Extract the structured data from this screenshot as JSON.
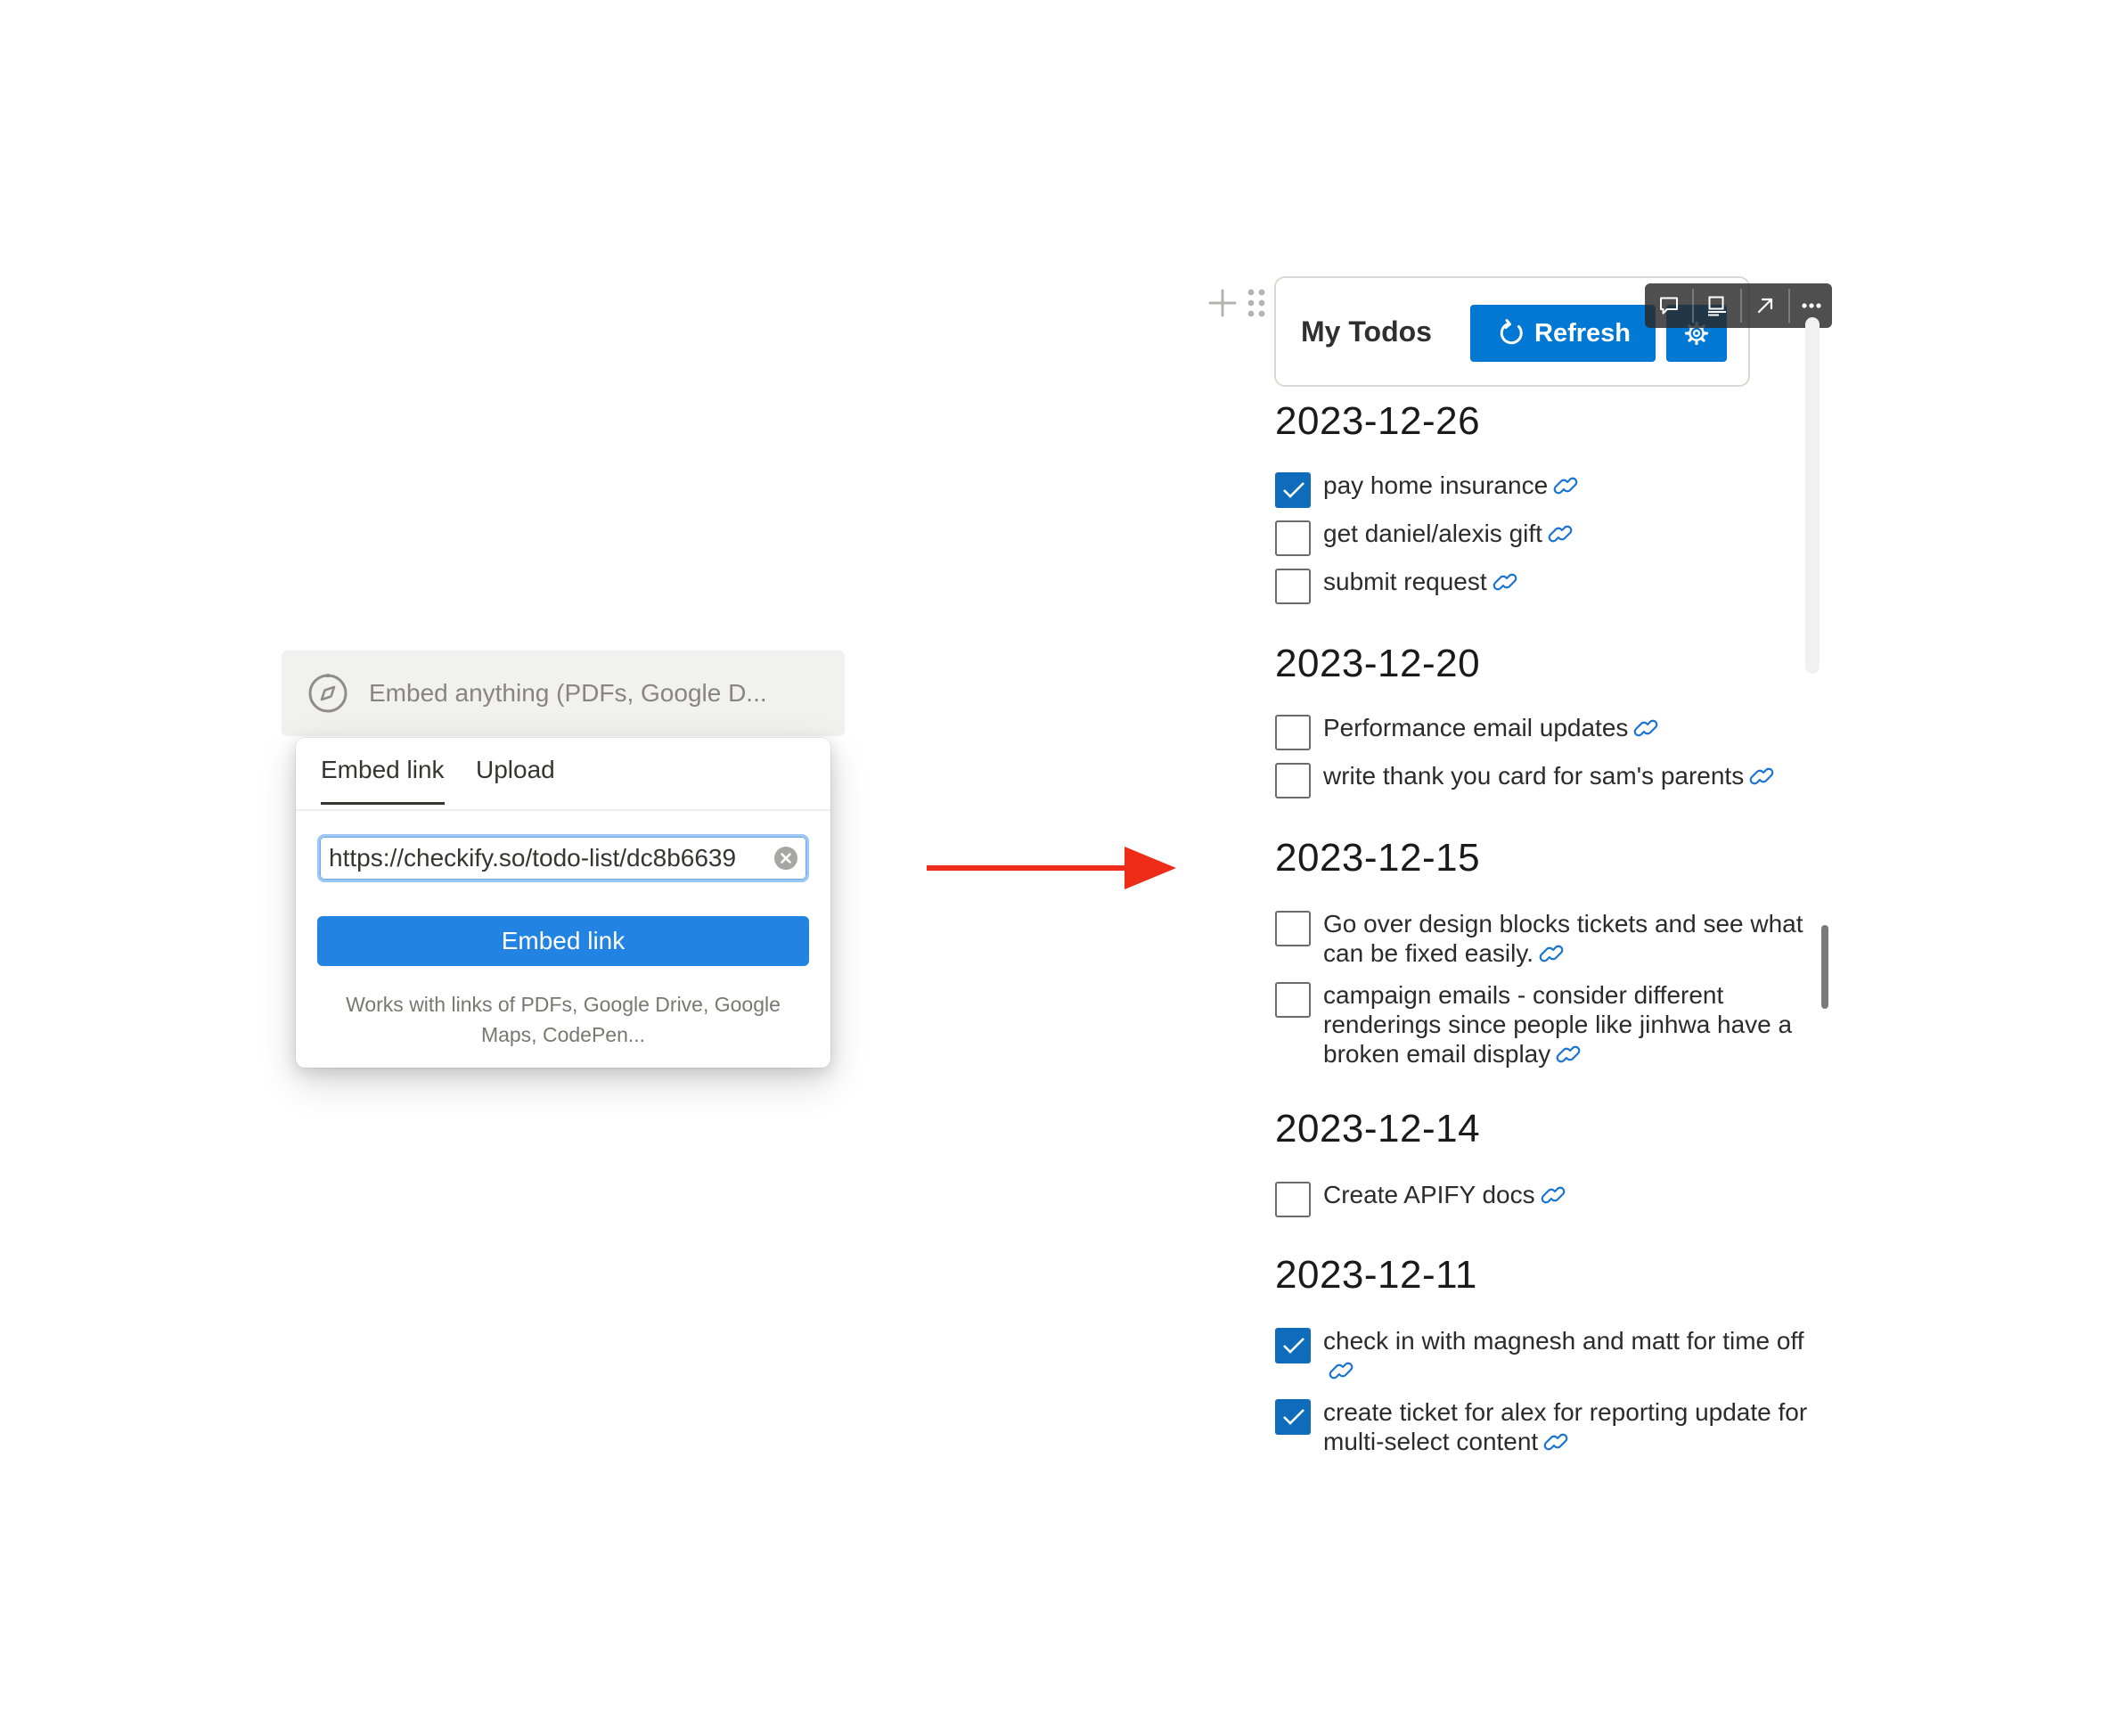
{
  "embed_block": {
    "placeholder": "Embed anything (PDFs, Google D...",
    "tabs": [
      {
        "label": "Embed link",
        "active": true
      },
      {
        "label": "Upload",
        "active": false
      }
    ],
    "url_value": "https://checkify.so/todo-list/dc8b6639",
    "embed_button": "Embed link",
    "hint": "Works with links of PDFs, Google Drive, Google Maps, CodePen..."
  },
  "arrow_color": "#ee2c17",
  "todo_embed": {
    "title": "My Todos",
    "refresh_label": "Refresh",
    "accent_color": "#0078d4",
    "groups": [
      {
        "date": "2023-12-26",
        "items": [
          {
            "text": "pay home insurance",
            "checked": true
          },
          {
            "text": "get daniel/alexis gift",
            "checked": false
          },
          {
            "text": "submit request",
            "checked": false
          }
        ]
      },
      {
        "date": "2023-12-20",
        "items": [
          {
            "text": "Performance email updates",
            "checked": false
          },
          {
            "text": "write thank you card for sam's parents",
            "checked": false
          }
        ]
      },
      {
        "date": "2023-12-15",
        "items": [
          {
            "text": "Go over design blocks tickets and see what can be fixed easily.",
            "checked": false
          },
          {
            "text": "campaign emails - consider different renderings since people like jinhwa have a broken email display",
            "checked": false
          }
        ]
      },
      {
        "date": "2023-12-14",
        "items": [
          {
            "text": "Create APIFY docs",
            "checked": false
          }
        ]
      },
      {
        "date": "2023-12-11",
        "items": [
          {
            "text": "check in with magnesh and matt for time off",
            "checked": true
          },
          {
            "text": "create ticket for alex for reporting update for multi-select content",
            "checked": true
          }
        ]
      }
    ]
  }
}
